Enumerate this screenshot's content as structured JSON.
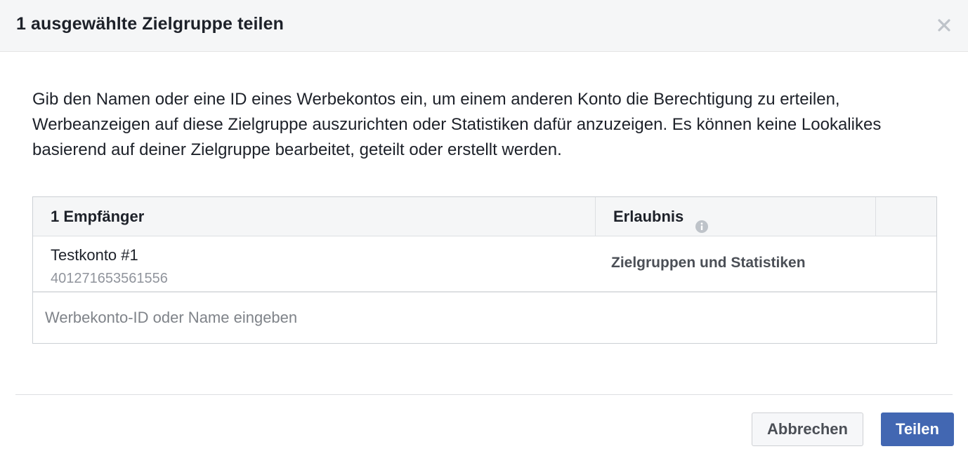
{
  "dialog": {
    "title": "1 ausgewählte Zielgruppe teilen",
    "close_icon": "close-icon",
    "description": "Gib den Namen oder eine ID eines Werbekontos ein, um einem anderen Konto die Berechtigung zu erteilen, Werbeanzeigen auf diese Zielgruppe auszurichten oder Statistiken dafür anzuzeigen. Es können keine Lookalikes basierend auf deiner Zielgruppe bearbeitet, geteilt oder erstellt werden."
  },
  "table": {
    "headers": {
      "recipients": "1 Empfänger",
      "permission": "Erlaubnis",
      "permission_icon": "info-icon"
    },
    "rows": [
      {
        "name": "Testkonto #1",
        "id": "401271653561556",
        "permission": "Zielgruppen und Statistiken"
      }
    ],
    "input": {
      "value": "",
      "placeholder": "Werbekonto-ID oder Name eingeben"
    }
  },
  "footer": {
    "cancel_label": "Abbrechen",
    "share_label": "Teilen"
  },
  "colors": {
    "primary_button": "#4267b2",
    "header_background": "#f5f6f7",
    "secondary_text": "#90949c"
  }
}
